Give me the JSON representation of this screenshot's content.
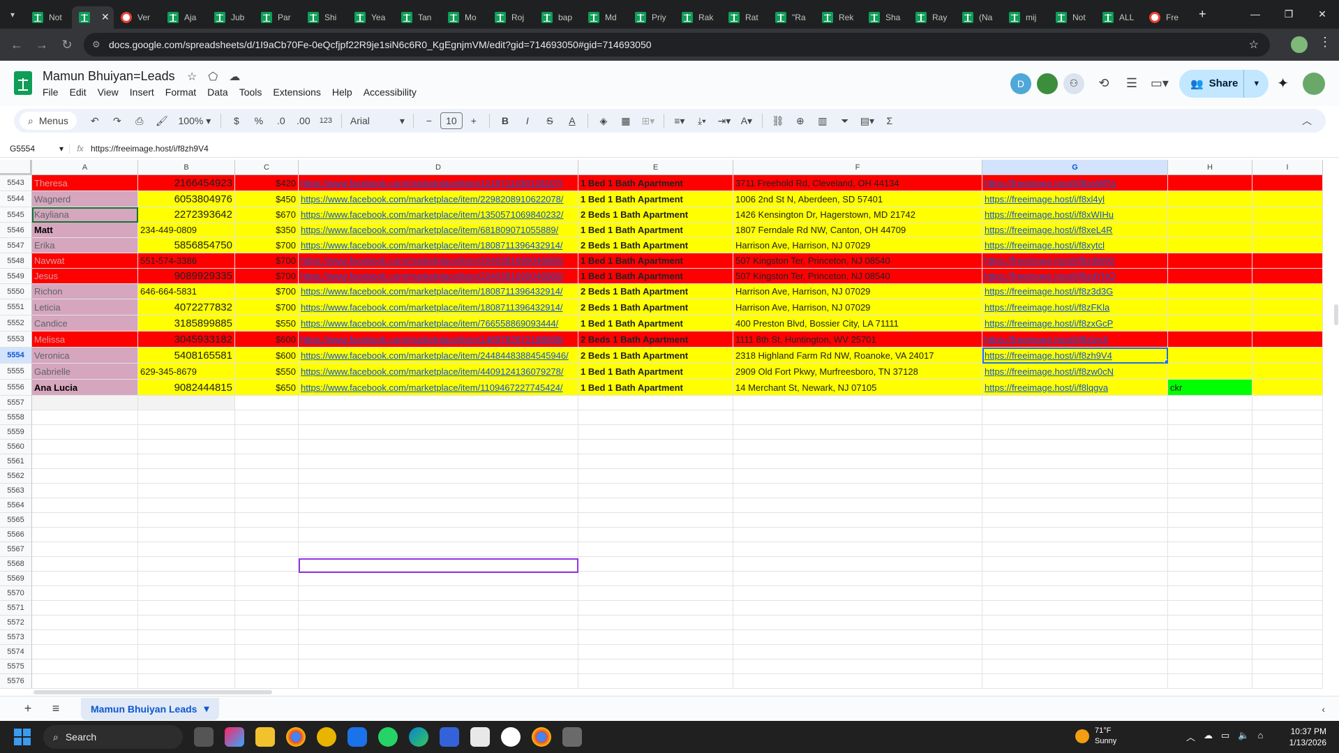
{
  "browser": {
    "tabs": [
      {
        "label": "Not",
        "icon": "sheets-icon"
      },
      {
        "label": "",
        "icon": "sheets-icon",
        "active": true
      },
      {
        "label": "Ver",
        "icon": "web-icon"
      },
      {
        "label": "Aja",
        "icon": "sheets-icon"
      },
      {
        "label": "Jub",
        "icon": "sheets-icon"
      },
      {
        "label": "Par",
        "icon": "sheets-icon"
      },
      {
        "label": "Shi",
        "icon": "sheets-icon"
      },
      {
        "label": "Yea",
        "icon": "sheets-icon"
      },
      {
        "label": "Tan",
        "icon": "sheets-icon"
      },
      {
        "label": "Mo",
        "icon": "sheets-icon"
      },
      {
        "label": "Roj",
        "icon": "sheets-icon"
      },
      {
        "label": "bap",
        "icon": "sheets-icon"
      },
      {
        "label": "Md",
        "icon": "sheets-icon"
      },
      {
        "label": "Priy",
        "icon": "sheets-icon"
      },
      {
        "label": "Rak",
        "icon": "sheets-icon"
      },
      {
        "label": "Rat",
        "icon": "sheets-icon"
      },
      {
        "label": "\"Ra",
        "icon": "sheets-icon"
      },
      {
        "label": "Rek",
        "icon": "sheets-icon"
      },
      {
        "label": "Sha",
        "icon": "sheets-icon"
      },
      {
        "label": "Ray",
        "icon": "sheets-icon"
      },
      {
        "label": "(Na",
        "icon": "sheets-icon"
      },
      {
        "label": "mij",
        "icon": "sheets-icon"
      },
      {
        "label": "Not",
        "icon": "sheets-icon"
      },
      {
        "label": "ALL",
        "icon": "sheets-icon"
      },
      {
        "label": "Fre",
        "icon": "web-icon"
      }
    ],
    "url": "docs.google.com/spreadsheets/d/1I9aCb70Fe-0eQcfjpf22R9je1siN6c6R0_KgEgnjmVM/edit?gid=714693050#gid=714693050"
  },
  "doc": {
    "title": "Mamun Bhuiyan=Leads",
    "menu": [
      "File",
      "Edit",
      "View",
      "Insert",
      "Format",
      "Data",
      "Tools",
      "Extensions",
      "Help",
      "Accessibility"
    ],
    "share_label": "Share",
    "avatar_letter": "D"
  },
  "toolbar": {
    "menus_label": "Menus",
    "zoom": "100%",
    "currency": "$",
    "percent": "%",
    "dec_decrease": ".0",
    "dec_increase": ".00",
    "format_123": "123",
    "font": "Arial",
    "font_size": "10"
  },
  "formula": {
    "cell_ref": "G5554",
    "value": "https://freeimage.host/i/f8zh9V4"
  },
  "columns": [
    "A",
    "B",
    "C",
    "D",
    "E",
    "F",
    "G",
    "H",
    "I"
  ],
  "rows": [
    {
      "n": "5543",
      "style": "red",
      "a": "Theresa",
      "b": "2166454923",
      "b_num": true,
      "c": "$420",
      "d": "https://www.facebook.com/marketplace/item/1219711430126107/",
      "e": "1 Bed 1 Bath Apartment",
      "f": "3711 Freehold Rd, Cleveland, OH  44134",
      "g": "https://freeimage.host/i/f8xnWPa",
      "h": ""
    },
    {
      "n": "5544",
      "style": "yellow",
      "a": "Wagnerd",
      "b": "6053804976",
      "b_num": true,
      "c": "$450",
      "d": "https://www.facebook.com/marketplace/item/2298208910622078/",
      "e": "1 Bed 1 Bath Apartment",
      "f": "1006 2nd St N, Aberdeen, SD  57401",
      "g": "https://freeimage.host/i/f8xl4yl",
      "h": ""
    },
    {
      "n": "5545",
      "style": "yellow",
      "a": "Kayliana",
      "b": "2272393642",
      "b_num": true,
      "c": "$670",
      "d": "https://www.facebook.com/marketplace/item/1350571069840232/",
      "e": "2 Beds 1 Bath Apartment",
      "f": "1426 Kensington Dr, Hagerstown, MD  21742",
      "g": "https://freeimage.host/i/f8xWIHu",
      "h": "",
      "a_sel": true
    },
    {
      "n": "5546",
      "style": "yellow",
      "a": "Matt",
      "a_dark": true,
      "b": "234-449-0809",
      "b_num": false,
      "c": "$350",
      "d": "https://www.facebook.com/marketplace/item/681809071055889/",
      "e": "1 Bed 1 Bath Apartment",
      "f": "1807 Ferndale Rd NW, Canton, OH  44709",
      "g": "https://freeimage.host/i/f8xeL4R",
      "h": ""
    },
    {
      "n": "5547",
      "style": "yellow",
      "a": "Erika",
      "b": "5856854750",
      "b_num": true,
      "c": "$700",
      "d": "https://www.facebook.com/marketplace/item/1808711396432914/",
      "e": "2 Beds 1 Bath Apartment",
      "f": "Harrison Ave, Harrison, NJ  07029",
      "g": "https://freeimage.host/i/f8xytcl",
      "h": ""
    },
    {
      "n": "5548",
      "style": "red",
      "a": "Navwat",
      "b": "551-574-3386",
      "b_num": false,
      "c": "$700",
      "d": "https://www.facebook.com/marketplace/item/2040381090046860/",
      "e": "1 Bed 1 Bath Apartment",
      "f": "507 Kingston Ter, Princeton, NJ  08540",
      "g": "https://freeimage.host/i/f8zdW92",
      "h": ""
    },
    {
      "n": "5549",
      "style": "red",
      "a": "Jesus",
      "b": "9089929335",
      "b_num": true,
      "c": "$700",
      "d": "https://www.facebook.com/marketplace/item/2040381090046860/",
      "e": "1 Bed 1 Bath Apartment",
      "f": "507 Kingston Ter, Princeton, NJ  08540",
      "g": "https://freeimage.host/i/f8zdYHQ",
      "h": ""
    },
    {
      "n": "5550",
      "style": "yellow",
      "a": "Richon",
      "b": "646-664-5831",
      "b_num": false,
      "c": "$700",
      "d": "https://www.facebook.com/marketplace/item/1808711396432914/",
      "e": "2 Beds 1 Bath Apartment",
      "f": "Harrison Ave, Harrison, NJ  07029",
      "g": "https://freeimage.host/i/f8z3d3G",
      "h": ""
    },
    {
      "n": "5551",
      "style": "yellow",
      "a": "Leticia",
      "b": "4072277832",
      "b_num": true,
      "c": "$700",
      "d": "https://www.facebook.com/marketplace/item/1808711396432914/",
      "e": "2 Beds 1 Bath Apartment",
      "f": "Harrison Ave, Harrison, NJ  07029",
      "g": "https://freeimage.host/i/f8zFKla",
      "h": ""
    },
    {
      "n": "5552",
      "style": "yellow",
      "a": "Candice",
      "b": "3185899885",
      "b_num": true,
      "c": "$550",
      "d": "https://www.facebook.com/marketplace/item/766558869093444/",
      "e": "1 Bed 1 Bath Apartment",
      "f": "400 Preston Blvd, Bossier City, LA  71111",
      "g": "https://freeimage.host/i/f8zxGcP",
      "h": ""
    },
    {
      "n": "5553",
      "style": "red",
      "a": "Melissa",
      "b": "3045933182",
      "b_num": true,
      "c": "$600",
      "d": "https://www.facebook.com/marketplace/item/1489782672198939/",
      "e": "2 Beds 1 Bath Apartment",
      "f": "1111 8th St, Huntington, WV  25701",
      "g": "https://freeimage.host/i/f8zIvyX",
      "h": ""
    },
    {
      "n": "5554",
      "style": "yellow",
      "a": "Veronica",
      "b": "5408165581",
      "b_num": true,
      "c": "$600",
      "d": "https://www.facebook.com/marketplace/item/24484483884545946/",
      "e": "2 Beds 1 Bath Apartment",
      "f": "2318 Highland Farm Rd NW, Roanoke, VA  24017",
      "g": "https://freeimage.host/i/f8zh9V4",
      "h": "",
      "g_sel": true
    },
    {
      "n": "5555",
      "style": "yellow",
      "a": "Gabrielle",
      "b": "629-345-8679",
      "b_num": false,
      "c": "$550",
      "d": "https://www.facebook.com/marketplace/item/4409124136079278/",
      "e": "1 Bed 1 Bath Apartment",
      "f": "2909 Old Fort Pkwy, Murfreesboro, TN  37128",
      "g": "https://freeimage.host/i/f8zw0cN",
      "h": ""
    },
    {
      "n": "5556",
      "style": "yellow",
      "a": "Ana Lucia",
      "a_dark": true,
      "b": "9082444815",
      "b_num": true,
      "c": "$650",
      "d": "https://www.facebook.com/marketplace/item/1109467227745424/",
      "e": "1 Bed 1 Bath Apartment",
      "f": "14 Merchant St, Newark, NJ  07105",
      "g": "https://freeimage.host/i/f8lqgva",
      "h": "ckr"
    }
  ],
  "empty_rows": [
    "5557",
    "5558",
    "5559",
    "5560",
    "5561",
    "5562",
    "5563",
    "5564",
    "5565",
    "5566",
    "5567",
    "5568",
    "5569",
    "5570",
    "5571",
    "5572",
    "5573",
    "5574",
    "5575",
    "5576"
  ],
  "sheet": {
    "tab_label": "Mamun Bhuiyan Leads"
  },
  "taskbar": {
    "search_label": "Search",
    "temperature": "71°F",
    "condition": "Sunny",
    "time": "10:37 PM",
    "date": "1/13/2026",
    "badge_count": "3"
  },
  "colors": {
    "red": "#ff0000",
    "yellow": "#ffff00",
    "pink": "#d5a6bd",
    "green": "#00ff00",
    "accent": "#0b57d0"
  }
}
